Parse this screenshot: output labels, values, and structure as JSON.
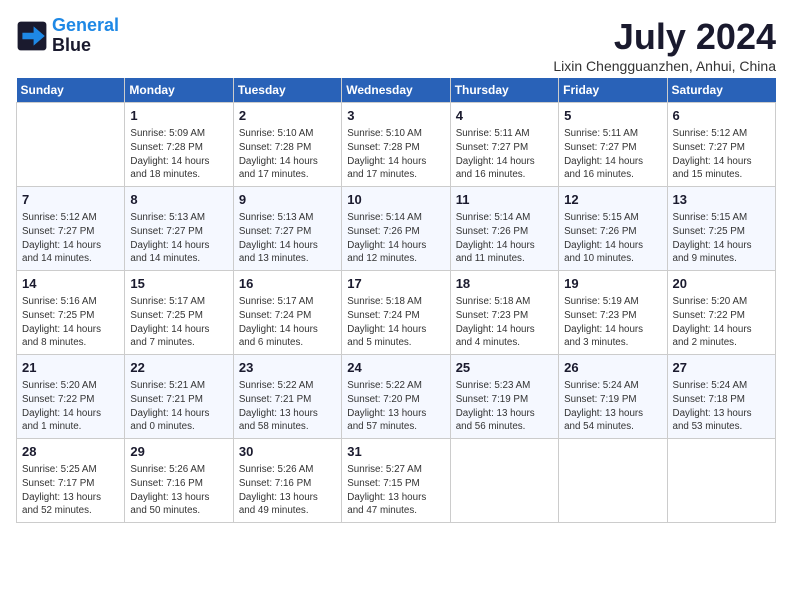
{
  "header": {
    "logo_line1": "General",
    "logo_line2": "Blue",
    "title": "July 2024",
    "location": "Lixin Chengguanzhen, Anhui, China"
  },
  "days_of_week": [
    "Sunday",
    "Monday",
    "Tuesday",
    "Wednesday",
    "Thursday",
    "Friday",
    "Saturday"
  ],
  "weeks": [
    [
      {
        "day": "",
        "info": ""
      },
      {
        "day": "1",
        "info": "Sunrise: 5:09 AM\nSunset: 7:28 PM\nDaylight: 14 hours\nand 18 minutes."
      },
      {
        "day": "2",
        "info": "Sunrise: 5:10 AM\nSunset: 7:28 PM\nDaylight: 14 hours\nand 17 minutes."
      },
      {
        "day": "3",
        "info": "Sunrise: 5:10 AM\nSunset: 7:28 PM\nDaylight: 14 hours\nand 17 minutes."
      },
      {
        "day": "4",
        "info": "Sunrise: 5:11 AM\nSunset: 7:27 PM\nDaylight: 14 hours\nand 16 minutes."
      },
      {
        "day": "5",
        "info": "Sunrise: 5:11 AM\nSunset: 7:27 PM\nDaylight: 14 hours\nand 16 minutes."
      },
      {
        "day": "6",
        "info": "Sunrise: 5:12 AM\nSunset: 7:27 PM\nDaylight: 14 hours\nand 15 minutes."
      }
    ],
    [
      {
        "day": "7",
        "info": "Sunrise: 5:12 AM\nSunset: 7:27 PM\nDaylight: 14 hours\nand 14 minutes."
      },
      {
        "day": "8",
        "info": "Sunrise: 5:13 AM\nSunset: 7:27 PM\nDaylight: 14 hours\nand 14 minutes."
      },
      {
        "day": "9",
        "info": "Sunrise: 5:13 AM\nSunset: 7:27 PM\nDaylight: 14 hours\nand 13 minutes."
      },
      {
        "day": "10",
        "info": "Sunrise: 5:14 AM\nSunset: 7:26 PM\nDaylight: 14 hours\nand 12 minutes."
      },
      {
        "day": "11",
        "info": "Sunrise: 5:14 AM\nSunset: 7:26 PM\nDaylight: 14 hours\nand 11 minutes."
      },
      {
        "day": "12",
        "info": "Sunrise: 5:15 AM\nSunset: 7:26 PM\nDaylight: 14 hours\nand 10 minutes."
      },
      {
        "day": "13",
        "info": "Sunrise: 5:15 AM\nSunset: 7:25 PM\nDaylight: 14 hours\nand 9 minutes."
      }
    ],
    [
      {
        "day": "14",
        "info": "Sunrise: 5:16 AM\nSunset: 7:25 PM\nDaylight: 14 hours\nand 8 minutes."
      },
      {
        "day": "15",
        "info": "Sunrise: 5:17 AM\nSunset: 7:25 PM\nDaylight: 14 hours\nand 7 minutes."
      },
      {
        "day": "16",
        "info": "Sunrise: 5:17 AM\nSunset: 7:24 PM\nDaylight: 14 hours\nand 6 minutes."
      },
      {
        "day": "17",
        "info": "Sunrise: 5:18 AM\nSunset: 7:24 PM\nDaylight: 14 hours\nand 5 minutes."
      },
      {
        "day": "18",
        "info": "Sunrise: 5:18 AM\nSunset: 7:23 PM\nDaylight: 14 hours\nand 4 minutes."
      },
      {
        "day": "19",
        "info": "Sunrise: 5:19 AM\nSunset: 7:23 PM\nDaylight: 14 hours\nand 3 minutes."
      },
      {
        "day": "20",
        "info": "Sunrise: 5:20 AM\nSunset: 7:22 PM\nDaylight: 14 hours\nand 2 minutes."
      }
    ],
    [
      {
        "day": "21",
        "info": "Sunrise: 5:20 AM\nSunset: 7:22 PM\nDaylight: 14 hours\nand 1 minute."
      },
      {
        "day": "22",
        "info": "Sunrise: 5:21 AM\nSunset: 7:21 PM\nDaylight: 14 hours\nand 0 minutes."
      },
      {
        "day": "23",
        "info": "Sunrise: 5:22 AM\nSunset: 7:21 PM\nDaylight: 13 hours\nand 58 minutes."
      },
      {
        "day": "24",
        "info": "Sunrise: 5:22 AM\nSunset: 7:20 PM\nDaylight: 13 hours\nand 57 minutes."
      },
      {
        "day": "25",
        "info": "Sunrise: 5:23 AM\nSunset: 7:19 PM\nDaylight: 13 hours\nand 56 minutes."
      },
      {
        "day": "26",
        "info": "Sunrise: 5:24 AM\nSunset: 7:19 PM\nDaylight: 13 hours\nand 54 minutes."
      },
      {
        "day": "27",
        "info": "Sunrise: 5:24 AM\nSunset: 7:18 PM\nDaylight: 13 hours\nand 53 minutes."
      }
    ],
    [
      {
        "day": "28",
        "info": "Sunrise: 5:25 AM\nSunset: 7:17 PM\nDaylight: 13 hours\nand 52 minutes."
      },
      {
        "day": "29",
        "info": "Sunrise: 5:26 AM\nSunset: 7:16 PM\nDaylight: 13 hours\nand 50 minutes."
      },
      {
        "day": "30",
        "info": "Sunrise: 5:26 AM\nSunset: 7:16 PM\nDaylight: 13 hours\nand 49 minutes."
      },
      {
        "day": "31",
        "info": "Sunrise: 5:27 AM\nSunset: 7:15 PM\nDaylight: 13 hours\nand 47 minutes."
      },
      {
        "day": "",
        "info": ""
      },
      {
        "day": "",
        "info": ""
      },
      {
        "day": "",
        "info": ""
      }
    ]
  ]
}
